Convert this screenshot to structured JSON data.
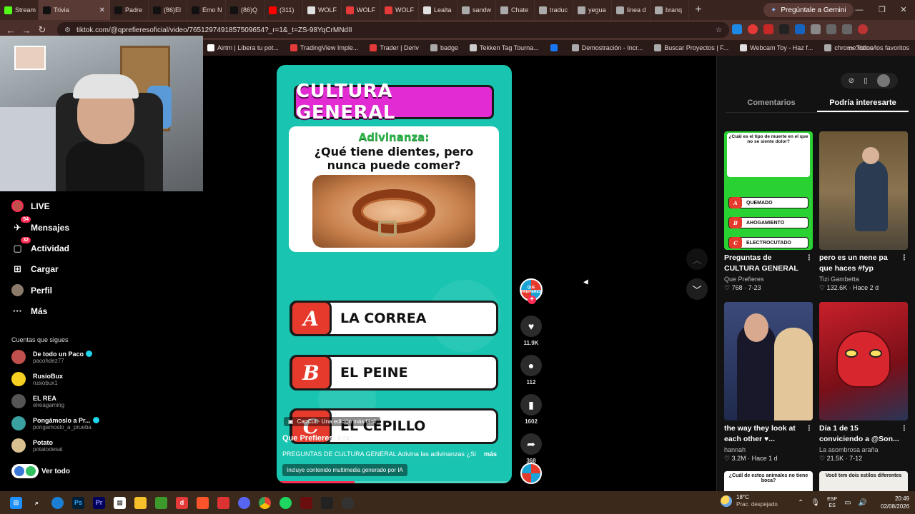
{
  "browser": {
    "tabs": [
      {
        "label": "Stream",
        "color": "#53fc18"
      },
      {
        "label": "Trivia",
        "color": "#111111"
      },
      {
        "label": "Padre",
        "color": "#111111"
      },
      {
        "label": "(86)El",
        "color": "#111111"
      },
      {
        "label": "Emo N",
        "color": "#111111"
      },
      {
        "label": "(86)Q",
        "color": "#111111"
      },
      {
        "label": "(311)",
        "color": "#ff0000"
      },
      {
        "label": "WOLF",
        "color": "#e0e0e0"
      },
      {
        "label": "WOLF",
        "color": "#e53a3a"
      },
      {
        "label": "WOLF",
        "color": "#e53a3a"
      },
      {
        "label": "Lealta",
        "color": "#e0e0e0"
      },
      {
        "label": "sandw",
        "color": "#aaaaaa"
      },
      {
        "label": "Chate",
        "color": "#aaaaaa"
      },
      {
        "label": "traduc",
        "color": "#aaaaaa"
      },
      {
        "label": "yegua",
        "color": "#aaaaaa"
      },
      {
        "label": "linea d",
        "color": "#aaaaaa"
      },
      {
        "label": "branq",
        "color": "#aaaaaa"
      }
    ],
    "gemini_label": "Pregúntale a Gemini",
    "url": "tiktok.com/@qprefieresoficial/video/7651297491857509654?_r=1&_t=ZS-98YqCrMNdII",
    "bookmarks": [
      {
        "label": "Airtm | Libera tu pot...",
        "color": "#ffffff"
      },
      {
        "label": "TradingView Imple...",
        "color": "#e53a3a"
      },
      {
        "label": "Trader | Deriv",
        "color": "#e53a3a"
      },
      {
        "label": "badge",
        "color": "#aaaaaa"
      },
      {
        "label": "Tekken Tag Tourna...",
        "color": "#cccccc"
      },
      {
        "label": "",
        "color": "#1877f2"
      },
      {
        "label": "Demostración - Incr...",
        "color": "#aaaaaa"
      },
      {
        "label": "Buscar Proyectos | F...",
        "color": "#aaaaaa"
      },
      {
        "label": "Webcam Toy - Haz f...",
        "color": "#e0e0e0"
      },
      {
        "label": "chrome://dino/",
        "color": "#aaaaaa"
      }
    ],
    "bookmarks_all": "Todos los favoritos"
  },
  "nav": {
    "live": "LIVE",
    "messages": "Mensajes",
    "messages_badge": "54",
    "activity": "Actividad",
    "activity_badge": "32",
    "upload": "Cargar",
    "profile": "Perfil",
    "more": "Más",
    "following_title": "Cuentas que sigues",
    "following": [
      {
        "name": "De todo un Paco",
        "handle": "pacohdez77",
        "verified": true,
        "color": "#c0504d"
      },
      {
        "name": "RusioBux",
        "handle": "rusiobux1",
        "verified": false,
        "color": "#f5d020"
      },
      {
        "name": "EL REA",
        "handle": "elreagaming",
        "verified": false,
        "color": "#555555"
      },
      {
        "name": "Pongámoslo a Pr...",
        "handle": "pongamoslo_a_prueba",
        "verified": true,
        "color": "#3aa0a0"
      },
      {
        "name": "Potato",
        "handle": "potatodesal",
        "verified": false,
        "color": "#d8c090"
      }
    ],
    "see_all": "Ver todo"
  },
  "video": {
    "title": "CULTURA GENERAL",
    "riddle_label": "Adivinanza:",
    "question": "¿Qué tiene dientes, pero nunca puede comer?",
    "options": [
      {
        "letter": "A",
        "text": "LA CORREA"
      },
      {
        "letter": "B",
        "text": "EL PEINE"
      },
      {
        "letter": "C",
        "text": "EL CEPILLO"
      }
    ],
    "capcut": "CapCut · Una edición más fácil",
    "author": "Que Prefieres",
    "date": "6-24",
    "description": "PREGUNTAS DE CULTURA GENERAL Adivina las adivinanzas ¿Si",
    "more": "más",
    "ai_badge": "Incluye contenido multimedia generado por IA",
    "progress": 0.33
  },
  "actions": {
    "avatar_text": "QUE PREFIERES",
    "likes": "11.9K",
    "comments": "112",
    "saves": "1602",
    "shares": "368"
  },
  "panel": {
    "tab_comments": "Comentarios",
    "tab_interest": "Podría interesarte",
    "recs": [
      {
        "title": "Preguntas de CULTURA GENERAL cuál es el ti...",
        "author": "Que Prefieres",
        "likes": "768",
        "date": "7-23"
      },
      {
        "title": "pero es un nene pa que haces #fyp #humor...",
        "author": "Tizi Gambetta",
        "likes": "132.6K",
        "date": "Hace 2 d"
      },
      {
        "title": "the way they look at each other ♥...",
        "author": "hannah",
        "likes": "3.2M",
        "date": "Hace 1 d"
      },
      {
        "title": "Día 1 de 15 conviciendo a @Son...",
        "author": "La asombrosa araña",
        "likes": "21.5K",
        "date": "7-12"
      }
    ],
    "quiz_thumb": {
      "question": "¿Cuál es el tipo de muerte en el que no se siente dolor?",
      "options": [
        {
          "letter": "A",
          "text": "QUEMADO"
        },
        {
          "letter": "B",
          "text": "AHOGAMIENTO"
        },
        {
          "letter": "C",
          "text": "ELECTROCUTADO"
        }
      ]
    },
    "peek1": "¿Cuál de estos animales no tiene boca?",
    "peek2": "Você tem dois estilos diferentes"
  },
  "taskbar": {
    "temp": "18°C",
    "condition": "Prac. despejado",
    "lang1": "ESP",
    "lang2": "ES",
    "time": "20:49",
    "date": "02/08/2026"
  },
  "colors": {
    "accent": "#fe2c55",
    "video_bg": "#19c4b0",
    "title_bg": "#e22bd2",
    "option_letter": "#e53a2c"
  }
}
